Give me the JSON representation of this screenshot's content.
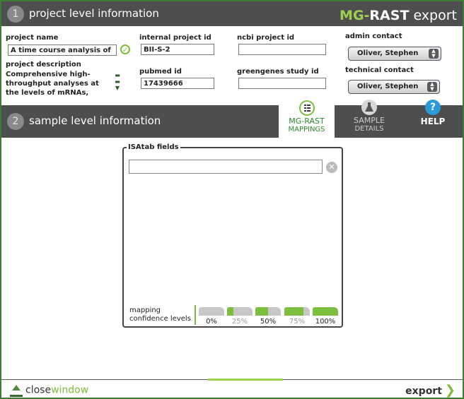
{
  "header": {
    "step": "1",
    "title": "project level information",
    "brand_mg": "MG-",
    "brand_rast": "RAST",
    "brand_export": " export"
  },
  "project": {
    "name_label": "project name",
    "name_value": "A time course analysis of",
    "internal_id_label": "internal project id",
    "internal_id_value": "BII-S-2",
    "ncbi_label": "ncbi project id",
    "ncbi_value": "",
    "description_label": "project description",
    "description_value": "Comprehensive high-throughput analyses at the levels of mRNAs,",
    "pubmed_label": "pubmed id",
    "pubmed_value": "17439666",
    "greengenes_label": "greengenes study id",
    "greengenes_value": "",
    "admin_label": "admin contact",
    "admin_value": "Oliver, Stephen",
    "technical_label": "technical contact",
    "technical_value": "Oliver, Stephen"
  },
  "section2": {
    "step": "2",
    "title": "sample level information"
  },
  "tabs": [
    {
      "line1": "MG-RAST",
      "line2": "MAPPINGS"
    },
    {
      "line1": "SAMPLE",
      "line2": "DETAILS"
    },
    {
      "line1": "HELP",
      "line2": ""
    }
  ],
  "panel": {
    "title": "ISAtab fields",
    "input_value": ""
  },
  "confidence": {
    "label_line1": "mapping",
    "label_line2": "confidence levels",
    "levels": [
      {
        "label": "0%",
        "fraction": 0.0
      },
      {
        "label": "25%",
        "fraction": 0.25
      },
      {
        "label": "50%",
        "fraction": 0.5
      },
      {
        "label": "75%",
        "fraction": 0.75
      },
      {
        "label": "100%",
        "fraction": 1.0
      }
    ]
  },
  "footer": {
    "close_prefix": "close",
    "close_suffix": "window",
    "export_label": "export"
  },
  "colors": {
    "accent": "#7cbf3c",
    "frame": "#3c7d34",
    "bar": "#4e4e4e",
    "help": "#2a9ad8"
  }
}
